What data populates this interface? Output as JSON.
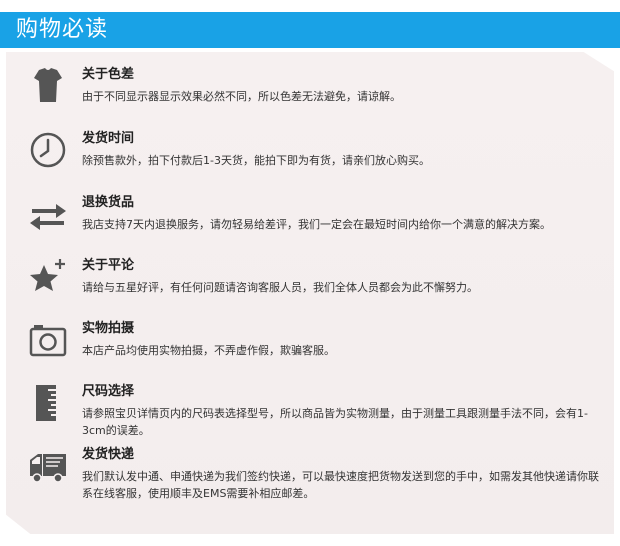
{
  "header": {
    "title": "购物必读",
    "color": "#19a2e6"
  },
  "items": [
    {
      "icon": "tshirt-icon",
      "title": "关于色差",
      "desc": "由于不同显示器显示效果必然不同，所以色差无法避免，请谅解。"
    },
    {
      "icon": "clock-icon",
      "title": "发货时间",
      "desc": "除预售款外，拍下付款后1-3天货，能拍下即为有货，请亲们放心购买。"
    },
    {
      "icon": "exchange-arrows-icon",
      "title": "退换货品",
      "desc": "我店支持7天内退换服务，请勿轻易给差评，我们一定会在最短时间内给你一个满意的解决方案。"
    },
    {
      "icon": "star-plus-icon",
      "title": "关于平论",
      "desc": "请给与五星好评，有任何问题请咨询客服人员，我们全体人员都会为此不懈努力。"
    },
    {
      "icon": "camera-icon",
      "title": "实物拍摄",
      "desc": "本店产品均使用实物拍摄，不弄虚作假，欺骗客服。"
    },
    {
      "icon": "ruler-icon",
      "title": "尺码选择",
      "desc": "请参照宝贝详情页内的尺码表选择型号，所以商品皆为实物测量，由于测量工具跟测量手法不同，会有1-3cm的误差。"
    },
    {
      "icon": "delivery-truck-icon",
      "title": "发货快递",
      "desc": "我们默认发中通、申通快递为我们签约快递，可以最快速度把货物发送到您的手中，如需发其他快递请你联系在线客服，使用顺丰及EMS需要补相应邮差。"
    }
  ]
}
